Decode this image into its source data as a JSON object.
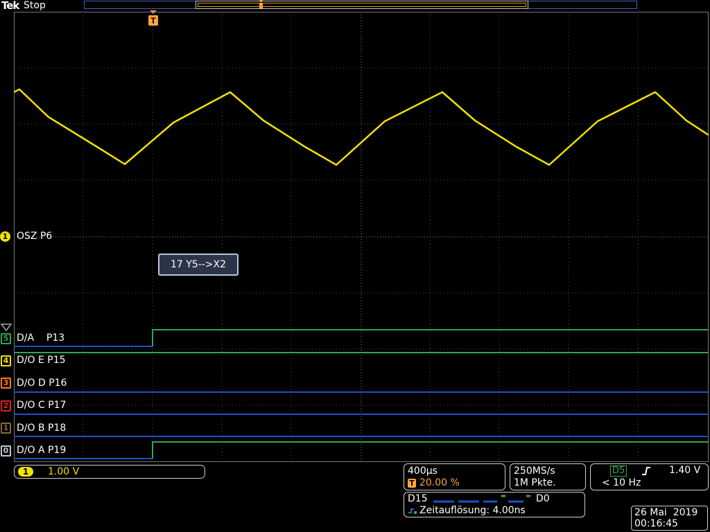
{
  "header": {
    "brand": "Tek",
    "status": "Stop",
    "trigger_marker": "T"
  },
  "screen": {
    "popup_text": "17 Y5-->X2"
  },
  "channels": [
    {
      "tag": "1",
      "label": "OSZ P6",
      "color": "#f2e300"
    },
    {
      "tag": "5",
      "label": "D/A    P13",
      "color": "#2fa84f"
    },
    {
      "tag": "4",
      "label": "D/O E P15",
      "color": "#f2e300"
    },
    {
      "tag": "3",
      "label": "D/O D P16",
      "color": "#ff7a18"
    },
    {
      "tag": "2",
      "label": "D/O C P17",
      "color": "#e02020"
    },
    {
      "tag": "1",
      "label": "D/O B P18",
      "color": "#8a6a3a"
    },
    {
      "tag": "0",
      "label": "D/O A P19",
      "color": "#c8c8c8"
    }
  ],
  "vertical": {
    "channel": "1",
    "scale": "1.00 V"
  },
  "horizontal": {
    "time_div": "400µs",
    "trigger_position": "20.00 %"
  },
  "acquisition": {
    "sample_rate": "250MS/s",
    "record_length": "1M Pkte."
  },
  "trigger": {
    "source": "D5",
    "slope_icon": "rising-edge-icon",
    "level": "1.40 V",
    "frequency": "< 10 Hz"
  },
  "digital": {
    "high_label": "D15",
    "low_label": "D0",
    "resolution": "Zeitauflösung: 4.00ns"
  },
  "datetime": {
    "date": "26 Mai  2019",
    "time": "00:16:45"
  },
  "colors": {
    "ch1": "#f2e300",
    "digital_high": "#2fa84f",
    "digital_low": "#1f4fc8",
    "trigger": "#ffa43a"
  }
}
